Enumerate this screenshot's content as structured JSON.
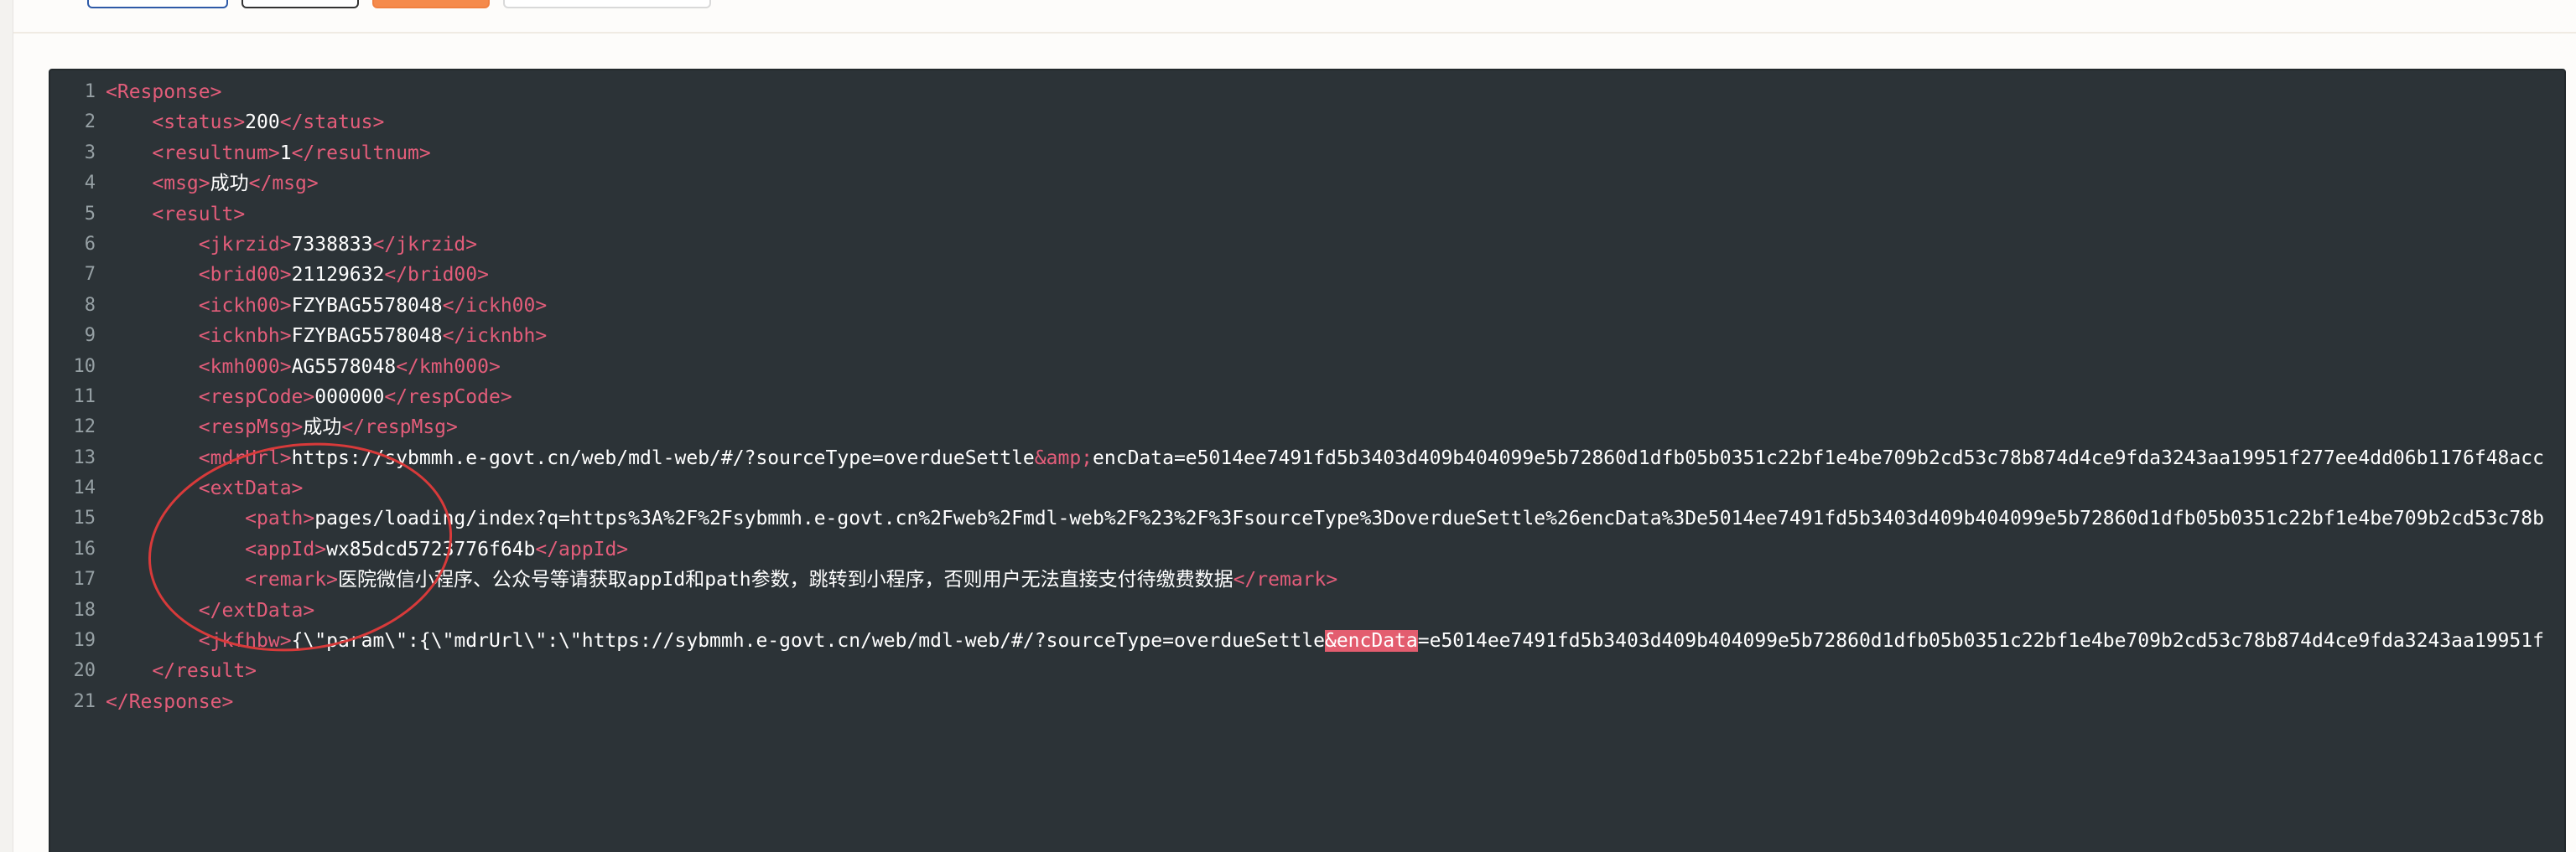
{
  "lines": [
    {
      "num": "1",
      "indent": "",
      "open": "<Response>",
      "text": "",
      "close": ""
    },
    {
      "num": "2",
      "indent": "    ",
      "open": "<status>",
      "text": "200",
      "close": "</status>"
    },
    {
      "num": "3",
      "indent": "    ",
      "open": "<resultnum>",
      "text": "1",
      "close": "</resultnum>"
    },
    {
      "num": "4",
      "indent": "    ",
      "open": "<msg>",
      "text": "成功",
      "close": "</msg>"
    },
    {
      "num": "5",
      "indent": "    ",
      "open": "<result>",
      "text": "",
      "close": ""
    },
    {
      "num": "6",
      "indent": "        ",
      "open": "<jkrzid>",
      "text": "7338833",
      "close": "</jkrzid>"
    },
    {
      "num": "7",
      "indent": "        ",
      "open": "<brid00>",
      "text": "21129632",
      "close": "</brid00>"
    },
    {
      "num": "8",
      "indent": "        ",
      "open": "<ickh00>",
      "text": "FZYBAG5578048",
      "close": "</ickh00>"
    },
    {
      "num": "9",
      "indent": "        ",
      "open": "<icknbh>",
      "text": "FZYBAG5578048",
      "close": "</icknbh>"
    },
    {
      "num": "10",
      "indent": "        ",
      "open": "<kmh000>",
      "text": "AG5578048",
      "close": "</kmh000>"
    },
    {
      "num": "11",
      "indent": "        ",
      "open": "<respCode>",
      "text": "000000",
      "close": "</respCode>"
    },
    {
      "num": "12",
      "indent": "        ",
      "open": "<respMsg>",
      "text": "成功",
      "close": "</respMsg>"
    },
    {
      "num": "13",
      "indent": "        ",
      "open": "<mdrUrl>",
      "text": "https://sybmmh.e-govt.cn/web/mdl-web/#/?sourceType=overdueSettle",
      "entity": "&amp;",
      "text2": "encData=e5014ee7491fd5b3403d409b404099e5b72860d1dfb05b0351c22bf1e4be709b2cd53c78b874d4ce9fda3243aa19951f277ee4dd06b1176f48acc",
      "close": ""
    },
    {
      "num": "14",
      "indent": "        ",
      "open": "<extData>",
      "text": "",
      "close": ""
    },
    {
      "num": "15",
      "indent": "            ",
      "open": "<path>",
      "text": "pages/loading/index?q=https%3A%2F%2Fsybmmh.e-govt.cn%2Fweb%2Fmdl-web%2F%23%2F%3FsourceType%3DoverdueSettle%26encData%3De5014ee7491fd5b3403d409b404099e5b72860d1dfb05b0351c22bf1e4be709b2cd53c78b",
      "close": ""
    },
    {
      "num": "16",
      "indent": "            ",
      "open": "<appId>",
      "text": "wx85dcd5723776f64b",
      "close": "</appId>"
    },
    {
      "num": "17",
      "indent": "            ",
      "open": "<remark>",
      "text": "医院微信小程序、公众号等请获取appId和path参数，跳转到小程序，否则用户无法直接支付待缴费数据",
      "close": "</remark>"
    },
    {
      "num": "18",
      "indent": "        ",
      "open": "</extData>",
      "text": "",
      "close": ""
    },
    {
      "num": "19",
      "indent": "        ",
      "open": "<jkfhbw>",
      "text": "{\\\"param\\\":{\\\"mdrUrl\\\":\\\"https://sybmmh.e-govt.cn/web/mdl-web/#/?sourceType=overdueSettle",
      "highlight": "&encData",
      "text2": "=e5014ee7491fd5b3403d409b404099e5b72860d1dfb05b0351c22bf1e4be709b2cd53c78b874d4ce9fda3243aa19951f",
      "close": ""
    },
    {
      "num": "20",
      "indent": "    ",
      "open": "</result>",
      "text": "",
      "close": ""
    },
    {
      "num": "21",
      "indent": "",
      "open": "</Response>",
      "text": "",
      "close": ""
    }
  ]
}
